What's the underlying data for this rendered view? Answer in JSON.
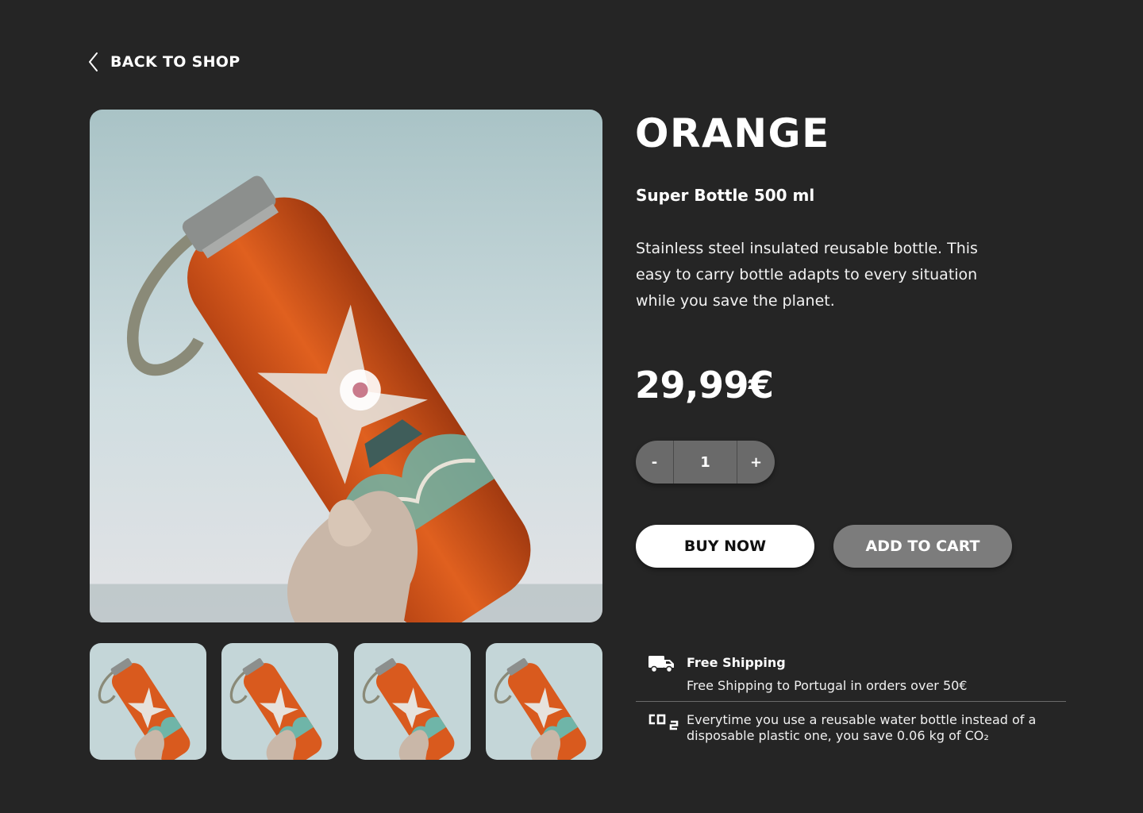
{
  "nav": {
    "back_label": "BACK TO SHOP"
  },
  "product": {
    "name": "ORANGE",
    "subtitle": "Super Bottle 500 ml",
    "description": "Stainless steel insulated reusable bottle. This easy to carry bottle adapts to every situation while you save the planet.",
    "price": "29,99€",
    "bottle_color": "#d95a1e"
  },
  "quantity": {
    "decrement_label": "-",
    "value": "1",
    "increment_label": "+"
  },
  "actions": {
    "buy_now_label": "BUY NOW",
    "add_to_cart_label": "ADD TO CART"
  },
  "info": {
    "shipping_title": "Free Shipping",
    "shipping_text": "Free Shipping to Portugal in orders over 50€",
    "co2_text": "Everytime you use a reusable water bottle instead of a disposable plastic one, you save 0.06 kg of CO₂",
    "shipping_icon": "truck-icon",
    "co2_icon": "co2-icon"
  },
  "gallery": {
    "thumbnail_count": 4
  },
  "colors": {
    "background": "#252525",
    "buy_button": "#ffffff",
    "cart_button": "#7c7c7c",
    "qty_background": "#6a6a6a"
  }
}
